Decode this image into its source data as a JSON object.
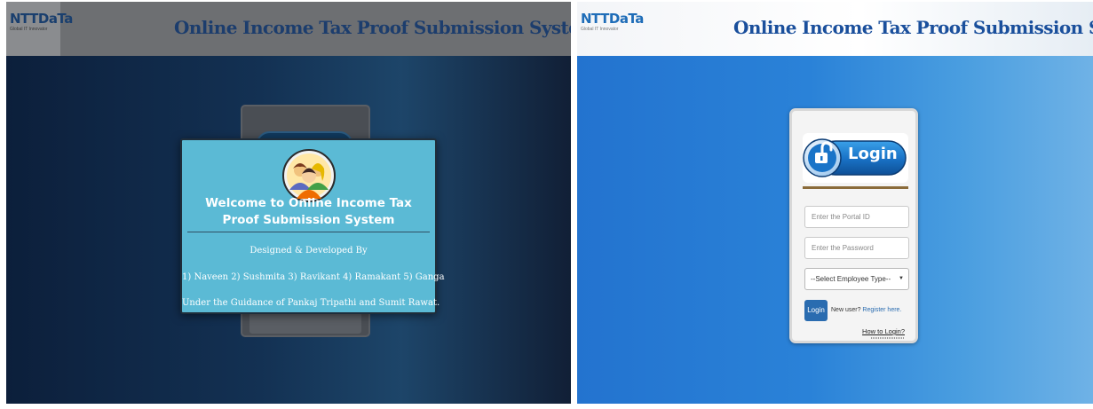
{
  "header": {
    "title": "Online Income Tax Proof Submission System",
    "logo_brand": "NTTDaTa",
    "logo_tagline": "Global IT Innovator"
  },
  "welcome_modal": {
    "title": "Welcome to Online Income Tax Proof Submission System",
    "designed_by": "Designed & Developed By",
    "developers": "1) Naveen 2) Sushmita 3) Ravikant 4) Ramakant 5) Ganga",
    "guidance": "Under the Guidance of Pankaj Tripathi and Sumit Rawat."
  },
  "login": {
    "banner_label": "Login",
    "portal_id_placeholder": "Enter the Portal ID",
    "password_placeholder": "Enter the Password",
    "employee_type_selected": "--Select Employee Type--",
    "login_button": "Login",
    "new_user_text": "New user?",
    "register_link": "Register here.",
    "how_to_login": "How to Login?"
  },
  "colors": {
    "header_title": "#1a4f9c",
    "login_button": "#2a6cb0",
    "modal_background": "#5bbad5",
    "right_background": "#2a82d8"
  }
}
